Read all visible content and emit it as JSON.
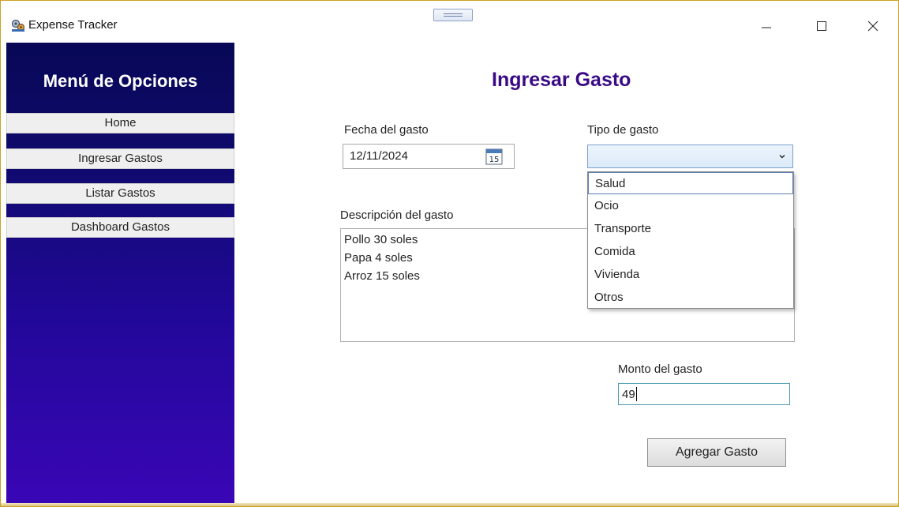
{
  "window": {
    "title": "Expense Tracker",
    "app_icon": "gears-icon",
    "controls": [
      "minimize-icon",
      "maximize-icon",
      "close-icon"
    ]
  },
  "sidebar": {
    "title": "Menú de Opciones",
    "items": [
      {
        "label": "Home"
      },
      {
        "label": "Ingresar Gastos"
      },
      {
        "label": "Listar Gastos"
      },
      {
        "label": "Dashboard Gastos"
      }
    ],
    "gradient_top": "#080856",
    "gradient_bottom": "#3a06b6"
  },
  "form": {
    "heading": "Ingresar Gasto",
    "heading_color": "#3a0a86",
    "date": {
      "label": "Fecha del gasto",
      "value": "12/11/2024",
      "calendar_day": "15"
    },
    "type": {
      "label": "Tipo de gasto",
      "selected_value": "",
      "options": [
        "Salud",
        "Ocio",
        "Transporte",
        "Comida",
        "Vivienda",
        "Otros"
      ],
      "highlighted": "Salud"
    },
    "description": {
      "label": "Descripción del gasto",
      "lines": [
        "Pollo 30 soles",
        "Papa 4 soles",
        "Arroz 15 soles"
      ]
    },
    "amount": {
      "label": "Monto del gasto",
      "value": "49"
    },
    "submit_label": "Agregar Gasto"
  }
}
